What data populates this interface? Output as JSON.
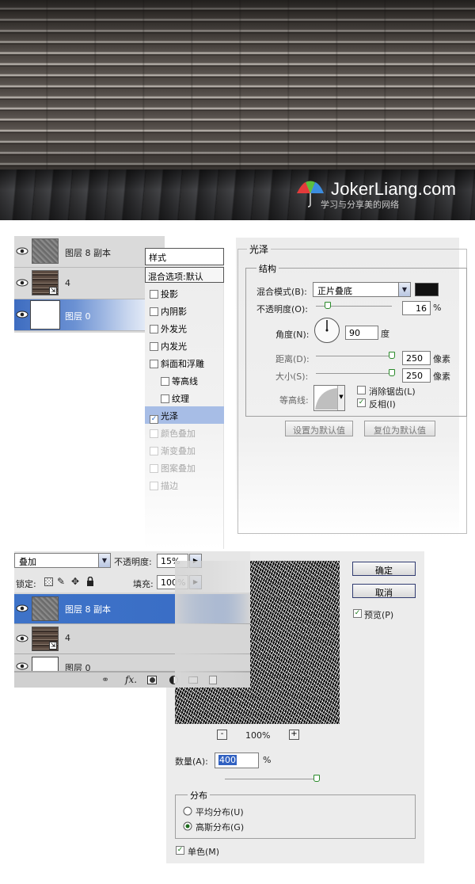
{
  "hero": {
    "logo_text": "JokerLiang.com",
    "logo_subtext": "学习与分享美的网络"
  },
  "layers_panel_1": {
    "layers": [
      {
        "name": "图层 8 副本",
        "thumb": "stone",
        "selected": false
      },
      {
        "name": "4",
        "thumb": "brick",
        "selected": false
      },
      {
        "name": "图层 0",
        "thumb": "white",
        "selected": true
      }
    ]
  },
  "layer_style": {
    "list_title": "样式",
    "blend_options": "混合选项:默认",
    "items": [
      {
        "label": "投影",
        "checked": false,
        "sub": false,
        "dim": false
      },
      {
        "label": "内阴影",
        "checked": false,
        "sub": false,
        "dim": false
      },
      {
        "label": "外发光",
        "checked": false,
        "sub": false,
        "dim": false
      },
      {
        "label": "内发光",
        "checked": false,
        "sub": false,
        "dim": false
      },
      {
        "label": "斜面和浮雕",
        "checked": false,
        "sub": false,
        "dim": false
      },
      {
        "label": "等高线",
        "checked": false,
        "sub": true,
        "dim": false
      },
      {
        "label": "纹理",
        "checked": false,
        "sub": true,
        "dim": false
      },
      {
        "label": "光泽",
        "checked": true,
        "sub": false,
        "dim": false,
        "active": true
      },
      {
        "label": "颜色叠加",
        "checked": false,
        "sub": false,
        "dim": true
      },
      {
        "label": "渐变叠加",
        "checked": false,
        "sub": false,
        "dim": true
      },
      {
        "label": "图案叠加",
        "checked": false,
        "sub": false,
        "dim": true
      },
      {
        "label": "描边",
        "checked": false,
        "sub": false,
        "dim": true
      }
    ]
  },
  "satin": {
    "title": "光泽",
    "structure_title": "结构",
    "blend_mode_label": "混合模式(B):",
    "blend_mode_value": "正片叠底",
    "blend_color": "#111111",
    "opacity_label": "不透明度(O):",
    "opacity_value": "16",
    "opacity_unit": "%",
    "opacity_level": 0.16,
    "angle_label": "角度(N):",
    "angle_value": "90",
    "angle_unit": "度",
    "distance_label": "距离(D):",
    "distance_value": "250",
    "distance_unit": "像素",
    "distance_level": 1.0,
    "size_label": "大小(S):",
    "size_value": "250",
    "size_unit": "像素",
    "size_level": 1.0,
    "contour_label": "等高线:",
    "anti_alias_label": "消除锯齿(L)",
    "anti_alias_checked": false,
    "invert_label": "反相(I)",
    "invert_checked": true,
    "set_default_label": "设置为默认值",
    "reset_default_label": "复位为默认值"
  },
  "layers_panel_2": {
    "blend_mode_value": "叠加",
    "opacity_label": "不透明度:",
    "opacity_value": "15%",
    "lock_label": "锁定:",
    "fill_label": "填充:",
    "fill_value": "100%",
    "layers": [
      {
        "name": "图层 8 副本",
        "thumb": "stone",
        "selected": true
      },
      {
        "name": "4",
        "thumb": "brick",
        "selected": false
      },
      {
        "name": "图层 0",
        "thumb": "white",
        "selected": false
      }
    ],
    "toolbar_icons": [
      "link-icon",
      "fx-icon",
      "mask-icon",
      "adjustment-icon",
      "folder-icon",
      "new-layer-icon"
    ],
    "fx_text": "fx."
  },
  "add_noise": {
    "ok_label": "确定",
    "cancel_label": "取消",
    "preview_label": "预览(P)",
    "preview_checked": true,
    "zoom_minus": "-",
    "zoom_value": "100%",
    "zoom_plus": "+",
    "amount_label": "数量(A):",
    "amount_value": "400",
    "amount_unit": "%",
    "amount_level": 1.0,
    "distribution_title": "分布",
    "uniform_label": "平均分布(U)",
    "uniform_selected": false,
    "gaussian_label": "高斯分布(G)",
    "gaussian_selected": true,
    "mono_label": "单色(M)",
    "mono_checked": true
  }
}
